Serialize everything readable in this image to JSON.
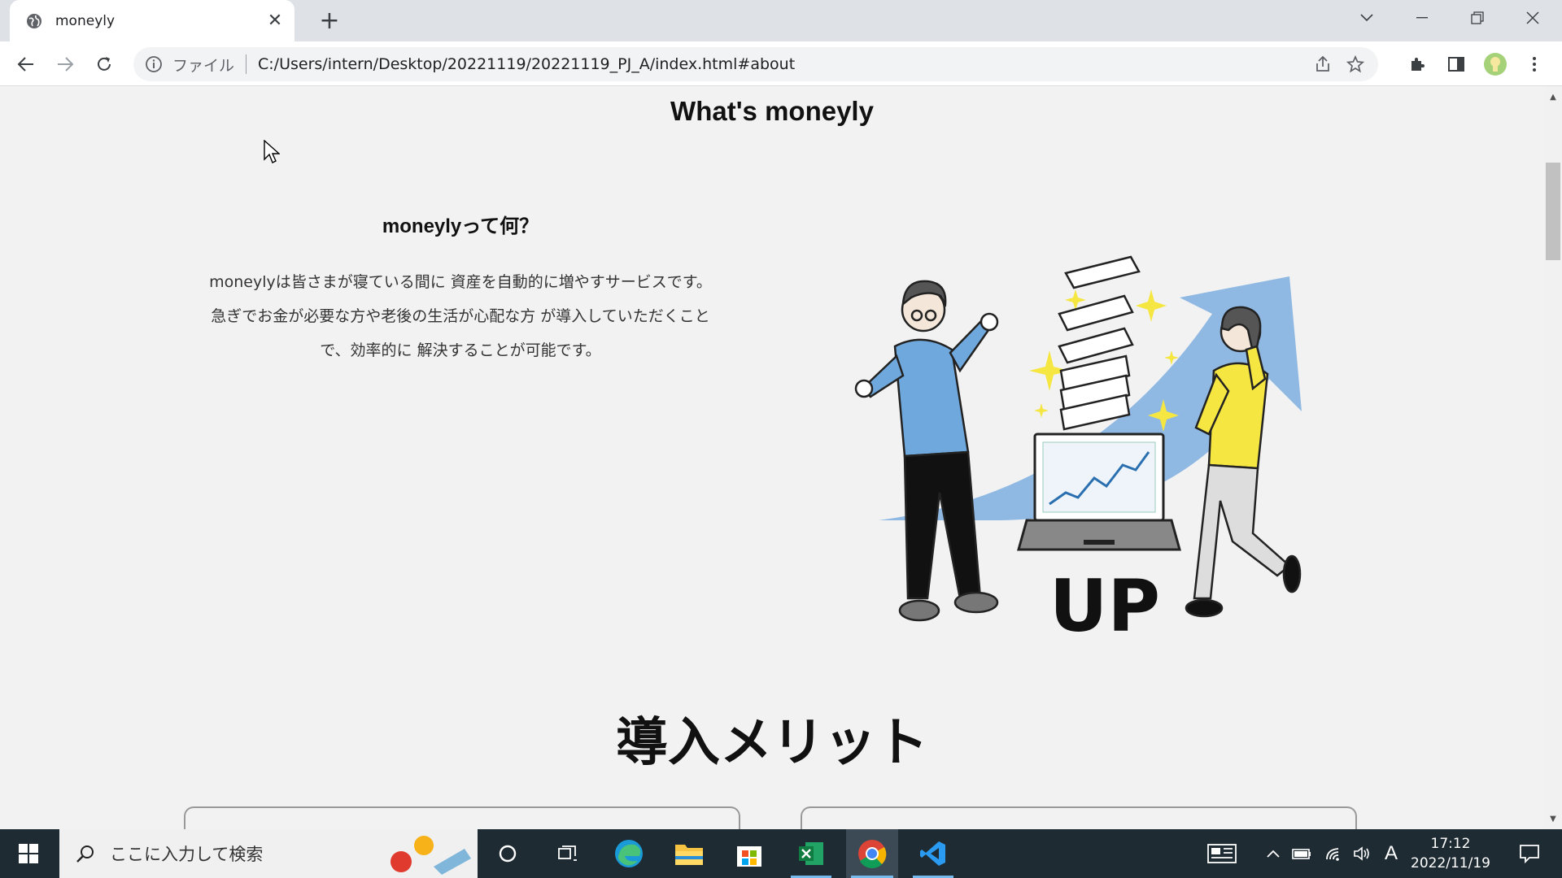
{
  "browser": {
    "tab_title": "moneyly",
    "address_prefix": "ファイル",
    "url": "C:/Users/intern/Desktop/20221119/20221119_PJ_A/index.html#about"
  },
  "page": {
    "section_title": "What's moneyly",
    "about": {
      "heading": "moneylyって何？",
      "lines": [
        "moneylyは皆さまが寝ている間に 資産を自動的に増やすサービスです。",
        "急ぎでお金が必要な方や老後の生活が心配な方 が導入していただくこと",
        "で、効率的に 解決することが可能です。"
      ]
    },
    "illustration_text": "UP",
    "merit_title": "導入メリット"
  },
  "taskbar": {
    "search_placeholder": "ここに入力して検索",
    "ime": "A",
    "time": "17:12",
    "date": "2022/11/19"
  },
  "colors": {
    "page_bg": "#f2f2f2",
    "illustration_blue": "#6fa8dc",
    "illustration_yellow": "#f5e642",
    "taskbar_bg": "#1f2b33"
  }
}
